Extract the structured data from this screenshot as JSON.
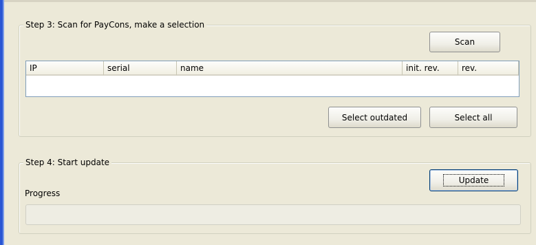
{
  "step3": {
    "caption": "Step 3: Scan for PayCons, make a selection",
    "scan_label": "Scan",
    "columns": [
      "IP",
      "serial",
      "name",
      "init. rev.",
      "rev."
    ],
    "select_outdated_label": "Select outdated",
    "select_all_label": "Select all"
  },
  "step4": {
    "caption": "Step 4: Start update",
    "update_label": "Update",
    "progress_label": "Progress",
    "progress_value": 0
  }
}
